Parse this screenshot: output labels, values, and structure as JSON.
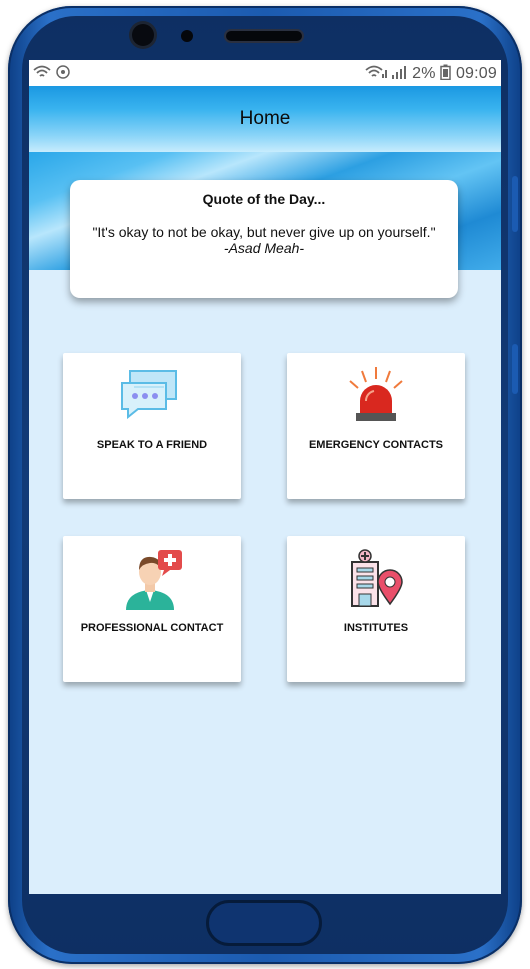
{
  "status_bar": {
    "left_icons": [
      "wifi-icon",
      "location-icon"
    ],
    "signal_text": "📶",
    "battery_text": "2%",
    "time": "09:09"
  },
  "header": {
    "title": "Home"
  },
  "quote": {
    "title": "Quote of the Day...",
    "text": "\"It's okay to not be okay, but never give up on yourself.\"",
    "author": "-Asad Meah-"
  },
  "tiles": [
    {
      "label": "SPEAK TO A FRIEND",
      "icon": "chat-bubbles-icon"
    },
    {
      "label": "EMERGENCY CONTACTS",
      "icon": "siren-icon"
    },
    {
      "label": "PROFESSIONAL CONTACT",
      "icon": "doctor-icon"
    },
    {
      "label": "INSTITUTES",
      "icon": "hospital-location-icon"
    }
  ],
  "colors": {
    "header_gradient_top": "#1b98e2",
    "screen_background": "#dbeefc",
    "frame_blue": "#1c5bb0",
    "siren_red": "#d9281f",
    "badge_red": "#e34b4b"
  }
}
